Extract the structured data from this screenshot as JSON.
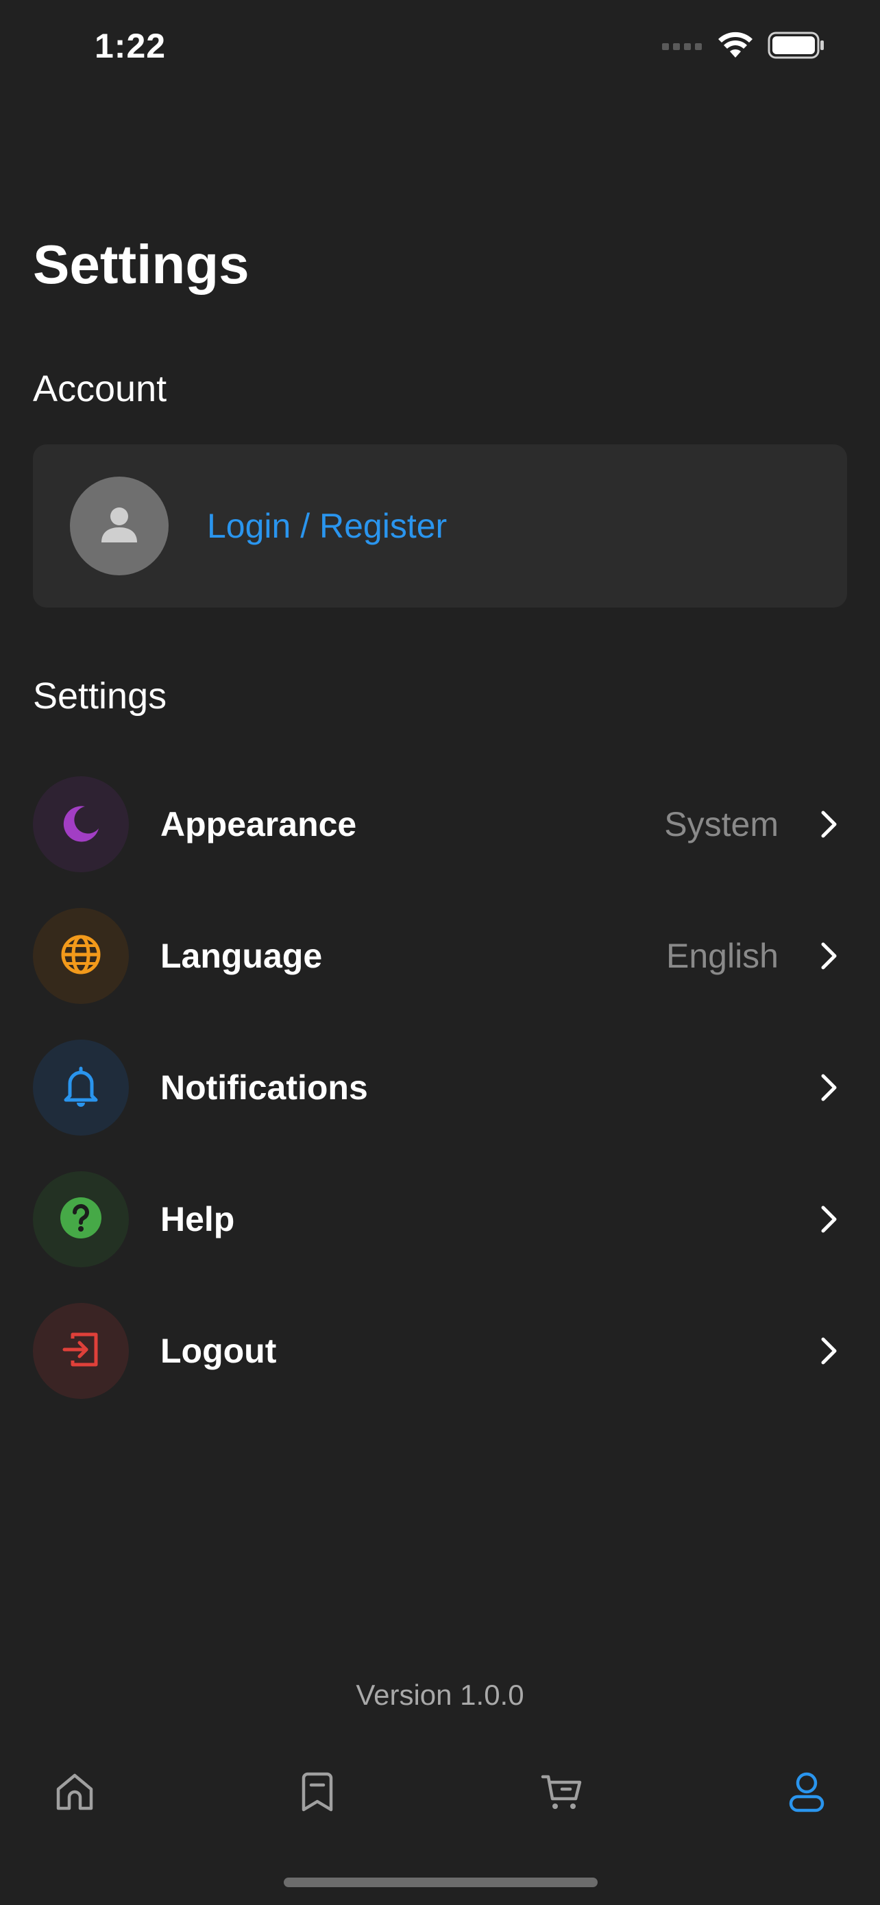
{
  "status_bar": {
    "time": "1:22",
    "signal_icon": "signal-dots-icon",
    "wifi_icon": "wifi-icon",
    "battery_icon": "battery-icon"
  },
  "page": {
    "title": "Settings"
  },
  "account": {
    "section_title": "Account",
    "avatar_icon": "person-icon",
    "login_label": "Login / Register",
    "link_color": "#2a95ee"
  },
  "settings": {
    "section_title": "Settings",
    "items": [
      {
        "label": "Appearance",
        "value": "System",
        "icon": "moon-icon",
        "color": "#a23ec4"
      },
      {
        "label": "Language",
        "value": "English",
        "icon": "globe-icon",
        "color": "#f39a1b"
      },
      {
        "label": "Notifications",
        "value": "",
        "icon": "bell-icon",
        "color": "#2a95ee"
      },
      {
        "label": "Help",
        "value": "",
        "icon": "help-icon",
        "color": "#46a947"
      },
      {
        "label": "Logout",
        "value": "",
        "icon": "logout-icon",
        "color": "#e0403a"
      }
    ]
  },
  "footer": {
    "version": "Version 1.0.0"
  },
  "tab_bar": {
    "tabs": [
      {
        "icon": "home-icon",
        "active": false
      },
      {
        "icon": "bookmark-icon",
        "active": false
      },
      {
        "icon": "cart-icon",
        "active": false
      },
      {
        "icon": "profile-icon",
        "active": true
      }
    ],
    "active_color": "#2a95ee",
    "inactive_color": "#a0a0a0"
  }
}
